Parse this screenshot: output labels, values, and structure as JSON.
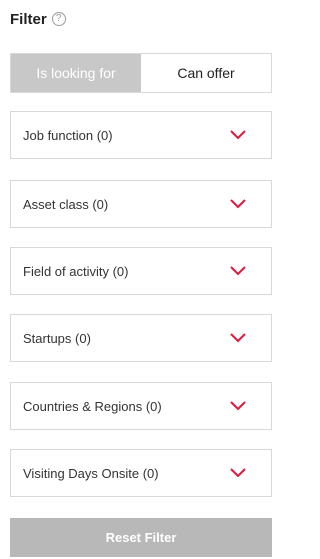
{
  "header": {
    "title": "Filter",
    "help_icon": "?"
  },
  "tabs": [
    {
      "label": "Is looking for",
      "active": true
    },
    {
      "label": "Can offer",
      "active": false
    }
  ],
  "filters": [
    {
      "label": "Job function (0)"
    },
    {
      "label": "Asset class (0)"
    },
    {
      "label": "Field of activity (0)"
    },
    {
      "label": "Startups (0)"
    },
    {
      "label": "Countries & Regions (0)"
    },
    {
      "label": "Visiting Days Onsite (0)"
    }
  ],
  "reset_button": {
    "label": "Reset Filter"
  },
  "colors": {
    "accent": "#e3173e",
    "active_tab_bg": "#c8c8c8",
    "reset_bg": "#b8b8b8",
    "border": "#d8d8d8"
  },
  "icons": {
    "help": "question-circle-icon",
    "dropdown": "chevron-down-icon"
  }
}
